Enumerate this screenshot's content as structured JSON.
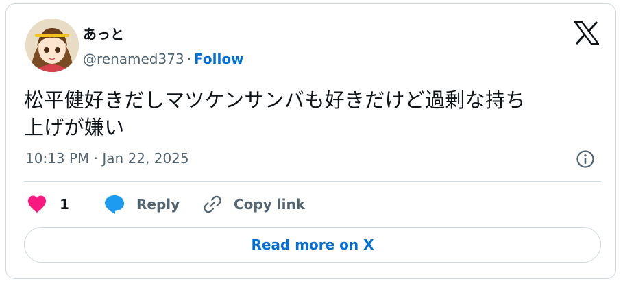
{
  "author": {
    "display_name": "あっと",
    "handle": "@renamed373",
    "separator": "·",
    "follow_label": "Follow"
  },
  "tweet": {
    "text_line1": "松平健好きだしマツケンサンバも好きだけど過剰な持ち",
    "text_line2": "上げが嫌い",
    "timestamp": "10:13 PM · Jan 22, 2025"
  },
  "actions": {
    "like_count": "1",
    "reply_label": "Reply",
    "copy_link_label": "Copy link"
  },
  "footer": {
    "read_more_label": "Read more on X"
  },
  "colors": {
    "accent": "#006fd6",
    "like": "#f91880",
    "reply_icon": "#1d9bf0",
    "secondary_text": "#536471",
    "border": "#cfd9de"
  },
  "icons": {
    "brand": "x-logo-icon",
    "info": "info-icon",
    "like": "heart-icon",
    "reply": "speech-bubble-icon",
    "copy": "link-icon"
  }
}
